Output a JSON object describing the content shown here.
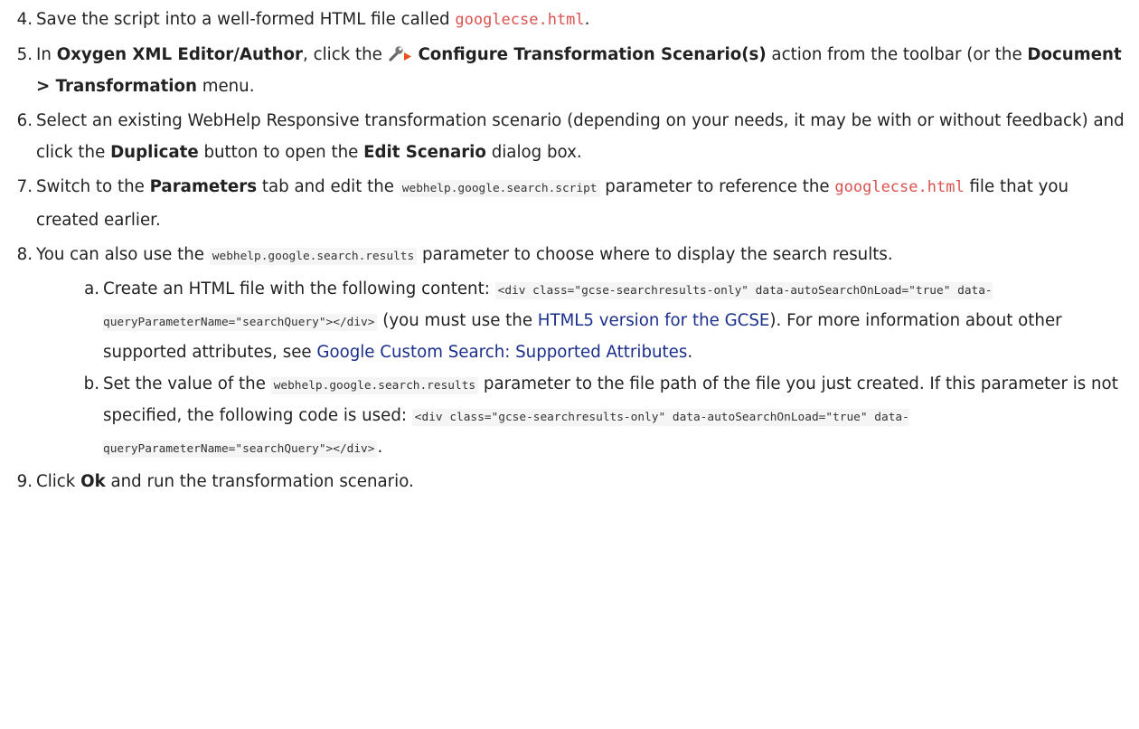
{
  "steps": [
    {
      "num": "4.",
      "pre": "Save the script into a well-formed HTML file called ",
      "file": "googlecse.html",
      "post": "."
    },
    {
      "num": "5.",
      "pre": "In ",
      "bold1": "Oxygen XML Editor/Author",
      "mid": ", click the ",
      "action": "Configure Transformation Scenario(s)",
      "mid2": " action from the toolbar (or the ",
      "menu": "Document > Transformation",
      "post": " menu."
    },
    {
      "num": "6.",
      "pre": "Select an existing WebHelp Responsive transformation scenario (depending on your needs, it may be with or without feedback) and click the ",
      "button": "Duplicate",
      "mid": " button to open the ",
      "dialog": "Edit Scenario",
      "post": " dialog box."
    },
    {
      "num": "7.",
      "pre": "Switch to the ",
      "tab": "Parameters",
      "mid": " tab and edit the ",
      "param": "webhelp.google.search.script",
      "mid2": " parameter to reference the ",
      "file": "googlecse.html",
      "post": " file that you created earlier."
    },
    {
      "num": "8.",
      "pre": "You can also use the ",
      "param": "webhelp.google.search.results",
      "post": " parameter to choose where to display the search results."
    },
    {
      "num": "9.",
      "pre": "Click ",
      "button": "Ok",
      "post": " and run the transformation scenario."
    }
  ],
  "substeps": [
    {
      "num": "a.",
      "pre": "Create an HTML file with the following content: ",
      "code": "<div class=\"gcse-searchresults-only\" data-autoSearchOnLoad=\"true\" data-queryParameterName=\"searchQuery\"></div>",
      "mid": " (you must use the ",
      "link1": "HTML5 version for the GCSE",
      "mid2": "). For more information about other supported attributes, see ",
      "link2": "Google Custom Search: Supported Attributes",
      "post": "."
    },
    {
      "num": "b.",
      "pre": "Set the value of the ",
      "param": "webhelp.google.search.results",
      "mid": " parameter to the file path of the file you just created. If this parameter is not specified, the following code is used: ",
      "code": "<div class=\"gcse-searchresults-only\" data-autoSearchOnLoad=\"true\" data-queryParameterName=\"searchQuery\"></div>",
      "post": "."
    }
  ],
  "icons": {
    "configure": "wrench-play-icon"
  }
}
